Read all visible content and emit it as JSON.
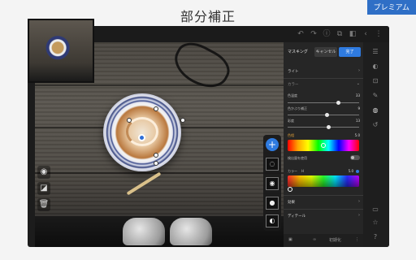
{
  "page": {
    "title": "部分補正",
    "badge": "プレミアム"
  },
  "topbar": {
    "icons": [
      "undo-icon",
      "redo-icon",
      "info-icon",
      "copy-icon",
      "compare-icon",
      "share-icon",
      "more-icon"
    ],
    "glyphs": [
      "↶",
      "↷",
      "ⓘ",
      "⧉",
      "◧",
      "‹",
      "⋮"
    ]
  },
  "panel": {
    "title": "マスキング",
    "cancel_label": "キャンセル",
    "done_label": "完了",
    "light_section": "ライト",
    "color_section": "カラー",
    "sliders": [
      {
        "label": "色温度",
        "value": "33",
        "fraction": 0.72
      },
      {
        "label": "色かぶり補正",
        "value": "9",
        "fraction": 0.56
      },
      {
        "label": "彩度",
        "value": "13",
        "fraction": 0.58
      },
      {
        "label": "色相",
        "value": "5.0",
        "fraction": 0.5
      }
    ],
    "toggle_label": "検出量を使用",
    "color_label": "カラー",
    "color_h_label": "H",
    "color_value": "5.0",
    "effect_section": "効果",
    "detail_section": "ディテール",
    "footer_label": "初期化"
  },
  "mask_tools": {
    "add_label": "+",
    "items": [
      "◌",
      "◉",
      "●",
      "◐"
    ]
  },
  "left_tools": {
    "glyphs": [
      "◉",
      "◪",
      "🗑"
    ]
  },
  "right_rail": {
    "icons": [
      "presets-icon",
      "edit-icon",
      "crop-icon",
      "brush-icon",
      "mask-icon",
      "history-icon",
      "comment-icon",
      "star-icon",
      "help-icon"
    ],
    "glyphs": [
      "☰",
      "◐",
      "⊡",
      "✎",
      "◍",
      "↺",
      "▭",
      "☆",
      "?"
    ]
  },
  "colors": {
    "accent": "#2f7be0",
    "badge": "#2f6fc6",
    "panel": "#262626"
  }
}
